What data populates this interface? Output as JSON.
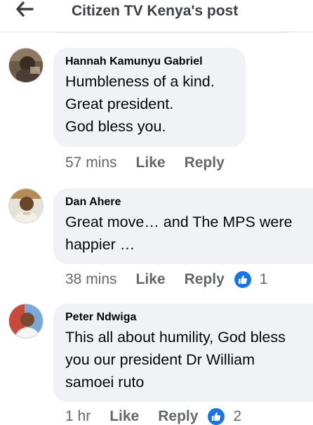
{
  "header": {
    "title": "Citizen TV Kenya's post"
  },
  "comments": [
    {
      "author": "Hannah Kamunyu Gabriel",
      "lines": [
        "Humbleness of a kind.",
        "Great president.",
        "God bless you."
      ],
      "time": "57 mins",
      "like_label": "Like",
      "reply_label": "Reply"
    },
    {
      "author": "Dan Ahere",
      "lines": [
        "Great move… and The MPS were",
        "happier …"
      ],
      "time": "38 mins",
      "like_label": "Like",
      "reply_label": "Reply",
      "reaction_count": "1"
    },
    {
      "author": "Peter Ndwiga",
      "lines": [
        "This all about humility, God bless",
        "you our president Dr William",
        "samoei ruto"
      ],
      "time": "1 hr",
      "like_label": "Like",
      "reply_label": "Reply",
      "reaction_count": "2"
    }
  ],
  "colors": {
    "like_blue": "#1b74e4",
    "bubble": "#f0f2f5",
    "meta": "#65676b"
  },
  "icons": {
    "back": "arrow-left-icon",
    "reaction": "thumbs-up-icon"
  }
}
